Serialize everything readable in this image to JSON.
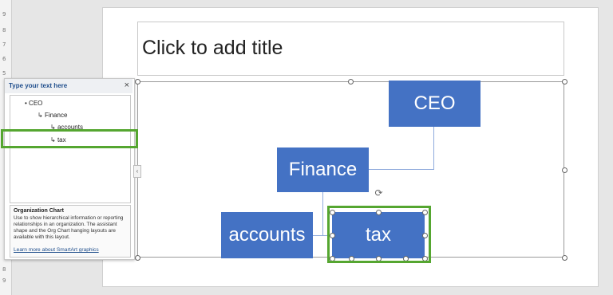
{
  "slide": {
    "title_placeholder": "Click to add title"
  },
  "ruler": {
    "ticks": [
      "9",
      "8",
      "7",
      "6",
      "5",
      "8",
      "9"
    ]
  },
  "org_chart": {
    "nodes": [
      {
        "label": "CEO"
      },
      {
        "label": "Finance"
      },
      {
        "label": "accounts"
      },
      {
        "label": "tax"
      }
    ]
  },
  "text_pane": {
    "title": "Type your text here",
    "close": "×",
    "toggle": "‹",
    "items": [
      {
        "prefix": "•",
        "label": "CEO"
      },
      {
        "prefix": "↳",
        "label": "Finance"
      },
      {
        "prefix": "↳",
        "label": "accounts"
      },
      {
        "prefix": "↳",
        "label": "tax"
      }
    ],
    "description": {
      "title": "Organization Chart",
      "body": "Use to show hierarchical information or reporting relationships in an organization. The assistant shape and the Org Chart hanging layouts are available with this layout.",
      "link": "Learn more about SmartArt graphics"
    }
  },
  "rotate_icon": "⟳",
  "colors": {
    "node_fill": "#4472c4",
    "highlight": "#55a630",
    "connector": "#8faadc"
  }
}
